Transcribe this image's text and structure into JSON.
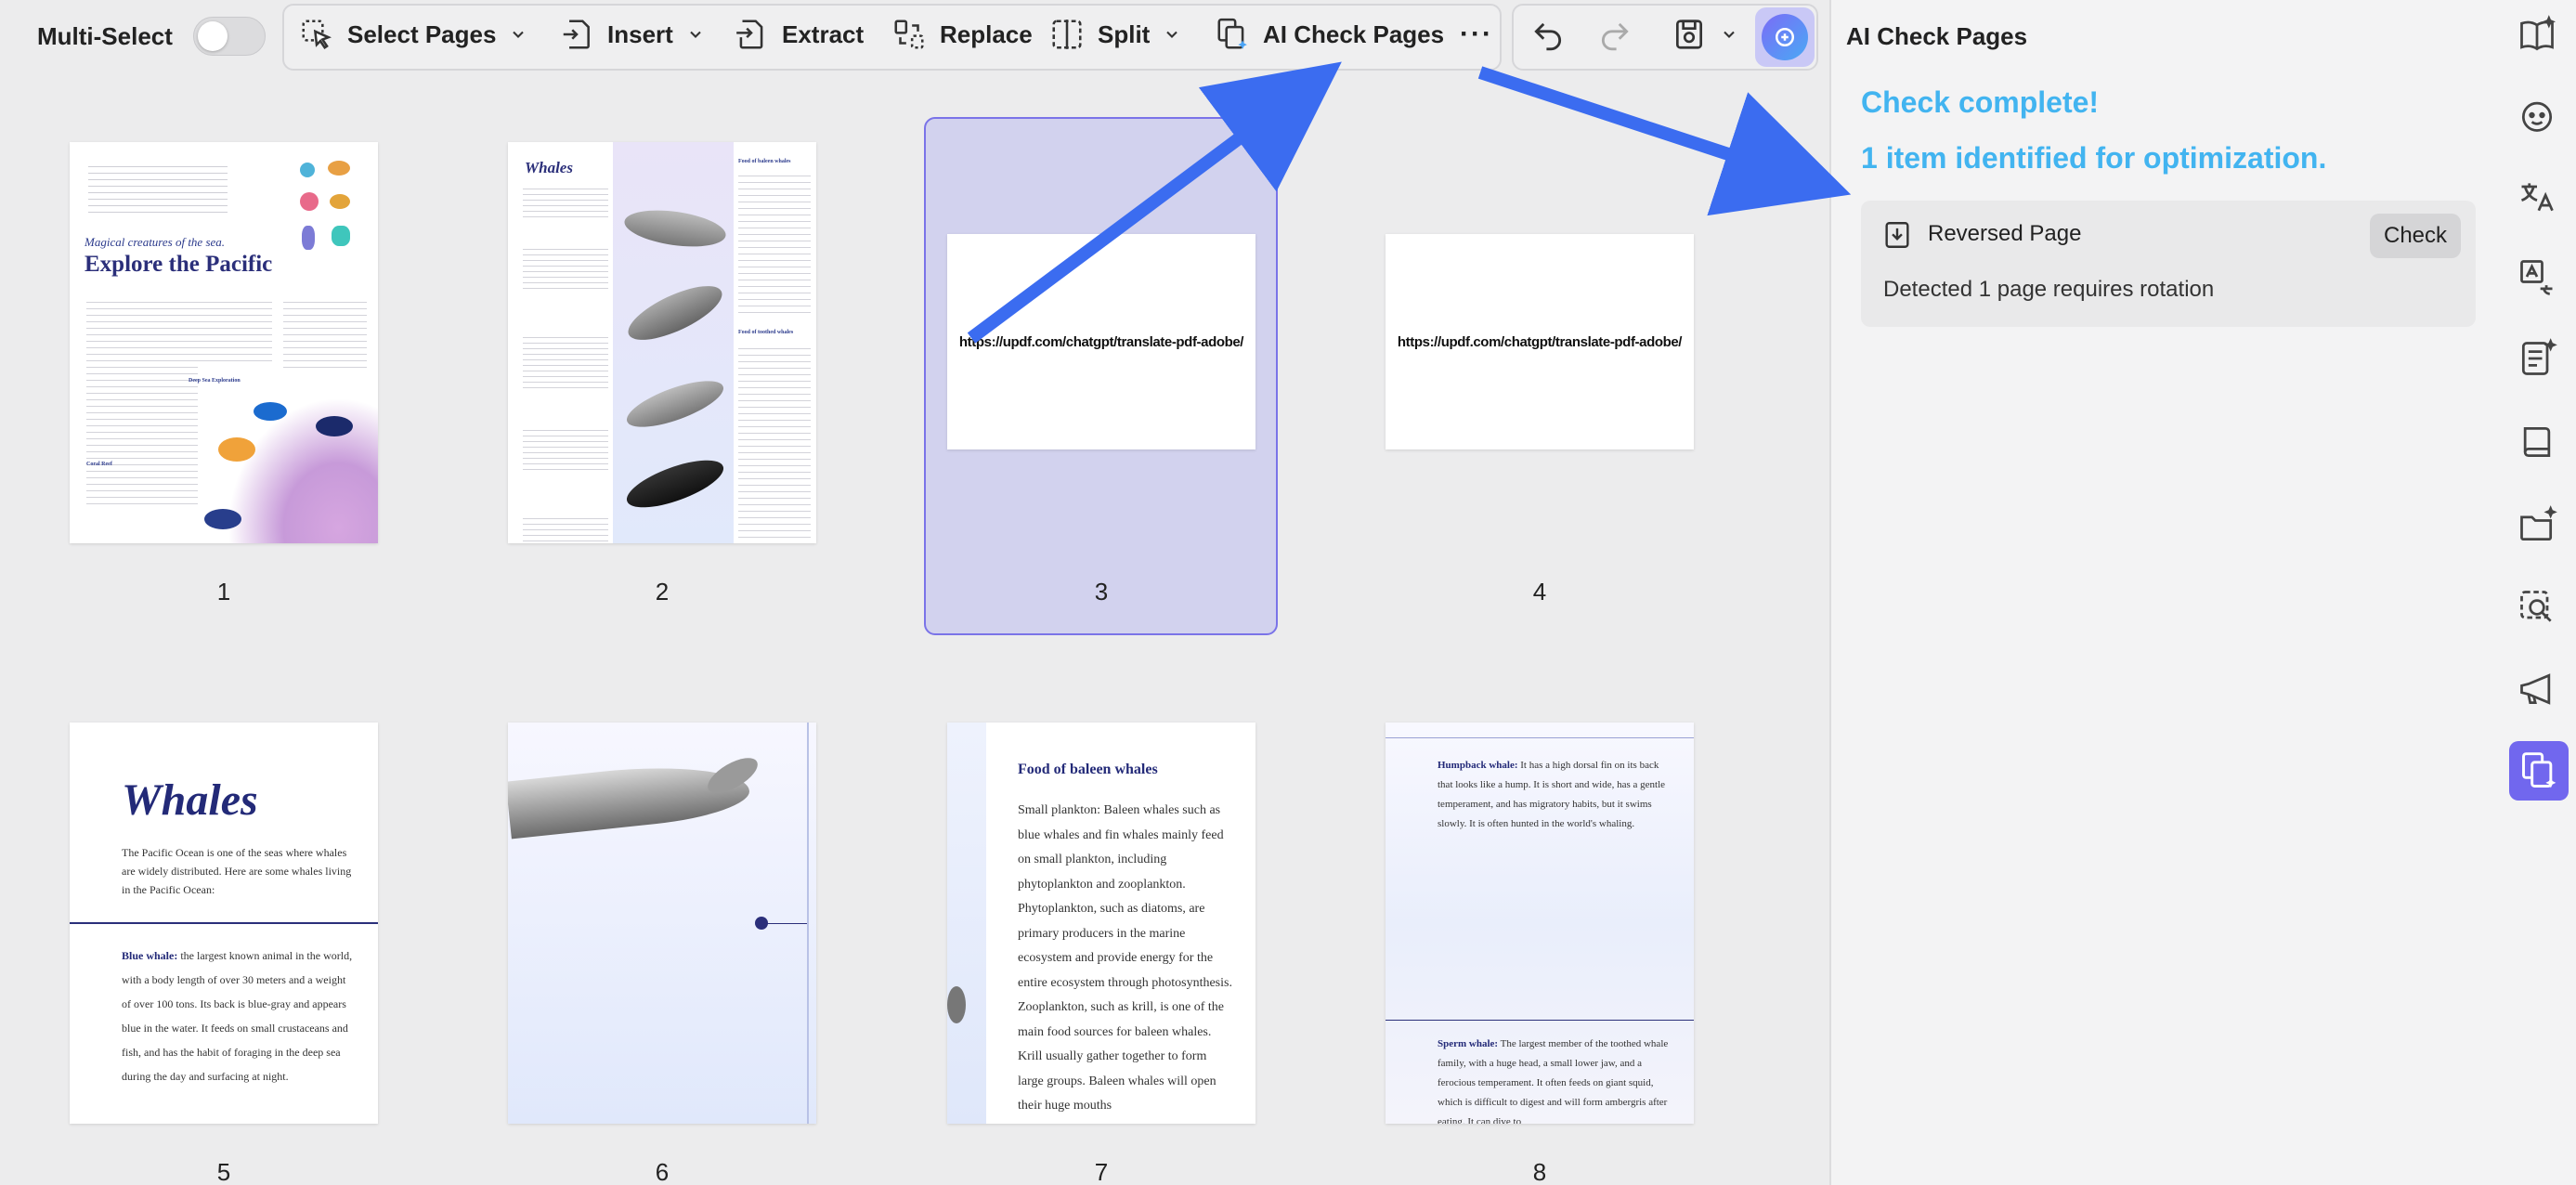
{
  "toolbar": {
    "multi_select_label": "Multi-Select",
    "select_pages_label": "Select Pages",
    "insert_label": "Insert",
    "extract_label": "Extract",
    "replace_label": "Replace",
    "split_label": "Split",
    "ai_check_label": "AI Check Pages",
    "more_label": "···"
  },
  "pages": {
    "numbers": [
      "1",
      "2",
      "3",
      "4",
      "5",
      "6",
      "7",
      "8"
    ],
    "url_text": "https://updf.com/chatgpt/translate-pdf-adobe/",
    "p1": {
      "subtitle": "Magical creatures of the sea.",
      "title": "Explore the Pacific",
      "deep_sea_heading": "Deep Sea Exploration",
      "coral_heading": "Coral Reef"
    },
    "p2": {
      "title": "Whales",
      "food_heading": "Food of baleen whales",
      "toothed_heading": "Food of toothed whales"
    },
    "p5": {
      "title": "Whales",
      "intro": "The Pacific Ocean is one of the seas where whales are widely distributed. Here are some whales living in the Pacific Ocean:",
      "blue_label": "Blue whale:",
      "blue_text": " the largest known animal in the world, with a body length of over 30 meters and a weight of over 100 tons. Its back is blue-gray and appears blue in the water. It feeds on small crustaceans and fish, and has the habit of foraging in the deep sea during the day and surfacing at night."
    },
    "p7": {
      "title": "Food of baleen whales",
      "text": "Small plankton: Baleen whales such as blue whales and fin whales mainly feed on small plankton, including phytoplankton and zooplankton. Phytoplankton, such as diatoms, are primary producers in the marine ecosystem and provide energy for the entire ecosystem through photosynthesis. Zooplankton, such as krill, is one of the main food sources for baleen whales. Krill usually gather together to form large groups. Baleen whales will open their huge mouths"
    },
    "p8": {
      "humpback_label": "Humpback whale:",
      "humpback_text": " It has a high dorsal fin on its back that looks like a hump. It is short and wide, has a gentle temperament, and has migratory habits, but it swims slowly. It is often hunted in the world's whaling.",
      "sperm_label": "Sperm whale:",
      "sperm_text": " The largest member of the toothed whale family, with a huge head, a small lower jaw, and a ferocious temperament. It often feeds on giant squid, which is difficult to digest and will form ambergris after eating. It can dive to"
    }
  },
  "panel": {
    "title": "AI Check Pages",
    "status_line1": "Check complete!",
    "status_line2": "1 item identified for optimization.",
    "item_title": "Reversed Page",
    "item_action": "Check",
    "item_desc": "Detected 1 page requires rotation"
  },
  "colors": {
    "accent": "#7167ee",
    "status_text": "#42b4f0",
    "arrow": "#3b6cf0",
    "selection_bg": "#d2d2ee"
  },
  "icons": {
    "sidebar": [
      "book-open-icon",
      "face-sparkle-icon",
      "translate-icon",
      "translate-text-icon",
      "doc-sparkle-icon",
      "book-icon",
      "folder-sparkle-icon",
      "search-doc-icon",
      "megaphone-icon",
      "ai-check-pages-icon"
    ]
  }
}
